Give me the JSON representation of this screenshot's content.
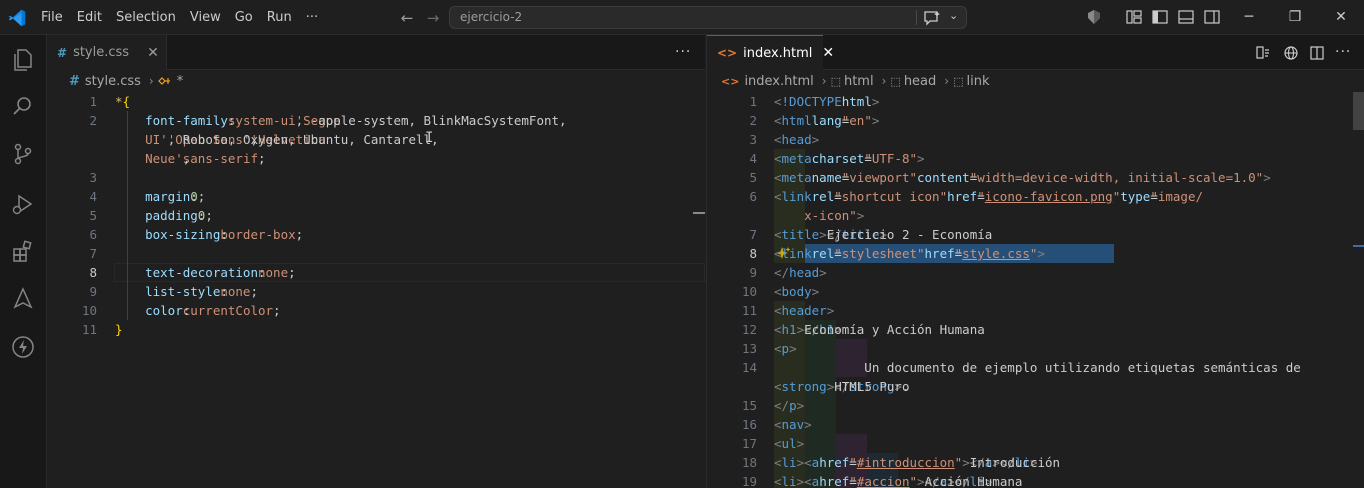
{
  "menu": [
    "File",
    "Edit",
    "Selection",
    "View",
    "Go",
    "Run",
    "···"
  ],
  "command_center": {
    "text": "ejercicio-2"
  },
  "window_controls": {
    "minimize": "─",
    "restore": "❐",
    "close": "✕"
  },
  "left_editor": {
    "tab": {
      "icon": "#",
      "label": "style.css",
      "close": "✕"
    },
    "more": "···",
    "breadcrumb": {
      "icon": "#",
      "file": "style.css",
      "sep": "›",
      "symbol": "*"
    },
    "lines": [
      {
        "n": "1",
        "segs": [
          [
            "sel",
            "*"
          ],
          [
            "brace",
            "{"
          ]
        ]
      },
      {
        "n": "2",
        "segs": [
          [
            "prop",
            "    font-family"
          ],
          [
            "txt",
            ": "
          ],
          [
            "val",
            "system-ui"
          ],
          [
            "txt",
            ", -apple-system, BlinkMacSystemFont, "
          ],
          [
            "val",
            "'Segoe"
          ]
        ]
      },
      {
        "n": "",
        "segs": [
          [
            "val",
            "    UI'"
          ],
          [
            "txt",
            ", Roboto, Oxygen, Ubuntu, Cantarell, "
          ],
          [
            "val",
            "'Open Sans'"
          ],
          [
            "txt",
            ", "
          ],
          [
            "val",
            "'Helvetica"
          ]
        ]
      },
      {
        "n": "",
        "segs": [
          [
            "val",
            "    Neue'"
          ],
          [
            "txt",
            ", "
          ],
          [
            "val",
            "sans-serif"
          ],
          [
            "txt",
            ";"
          ]
        ]
      },
      {
        "n": "3",
        "segs": []
      },
      {
        "n": "4",
        "segs": [
          [
            "prop",
            "    margin"
          ],
          [
            "txt",
            ":"
          ],
          [
            "num",
            "0"
          ],
          [
            "txt",
            ";"
          ]
        ]
      },
      {
        "n": "5",
        "segs": [
          [
            "prop",
            "    padding"
          ],
          [
            "txt",
            ": "
          ],
          [
            "num",
            "0"
          ],
          [
            "txt",
            ";"
          ]
        ]
      },
      {
        "n": "6",
        "segs": [
          [
            "prop",
            "    box-sizing"
          ],
          [
            "txt",
            ": "
          ],
          [
            "val",
            "border-box"
          ],
          [
            "txt",
            ";"
          ]
        ]
      },
      {
        "n": "7",
        "segs": []
      },
      {
        "n": "8",
        "segs": [
          [
            "prop",
            "    text-decoration"
          ],
          [
            "txt",
            ": "
          ],
          [
            "val",
            "none"
          ],
          [
            "txt",
            ";"
          ]
        ]
      },
      {
        "n": "9",
        "segs": [
          [
            "prop",
            "    list-style"
          ],
          [
            "txt",
            ": "
          ],
          [
            "val",
            "none"
          ],
          [
            "txt",
            ";"
          ]
        ]
      },
      {
        "n": "10",
        "segs": [
          [
            "prop",
            "    color"
          ],
          [
            "txt",
            ": "
          ],
          [
            "val",
            "currentColor"
          ],
          [
            "txt",
            ";"
          ]
        ]
      },
      {
        "n": "11",
        "segs": [
          [
            "brace",
            "}"
          ]
        ]
      }
    ]
  },
  "right_editor": {
    "tab": {
      "icon": "<>",
      "label": "index.html",
      "close": "✕"
    },
    "more": "···",
    "breadcrumb": [
      {
        "icon": "<>",
        "label": "index.html"
      },
      {
        "icon": "⬚",
        "label": "html"
      },
      {
        "icon": "⬚",
        "label": "head"
      },
      {
        "icon": "⬚",
        "label": "link"
      }
    ],
    "breadcrumb_sep": "›",
    "lines": [
      {
        "n": "1",
        "segs": [
          [
            "punct",
            "<"
          ],
          [
            "tag",
            "!DOCTYPE"
          ],
          [
            "txt",
            " "
          ],
          [
            "attr",
            "html"
          ],
          [
            "punct",
            ">"
          ]
        ]
      },
      {
        "n": "2",
        "segs": [
          [
            "punct",
            "<"
          ],
          [
            "tag",
            "html"
          ],
          [
            "txt",
            " "
          ],
          [
            "attr",
            "lang"
          ],
          [
            "txt",
            "="
          ],
          [
            "str",
            "\"en\""
          ],
          [
            "punct",
            ">"
          ]
        ]
      },
      {
        "n": "3",
        "segs": [
          [
            "punct",
            "<"
          ],
          [
            "tag",
            "head"
          ],
          [
            "punct",
            ">"
          ]
        ]
      },
      {
        "n": "4",
        "segs": [
          [
            "txt",
            "    "
          ],
          [
            "punct",
            "<"
          ],
          [
            "tag",
            "meta"
          ],
          [
            "txt",
            " "
          ],
          [
            "attr",
            "charset"
          ],
          [
            "txt",
            "="
          ],
          [
            "str",
            "\"UTF-8\""
          ],
          [
            "punct",
            ">"
          ]
        ]
      },
      {
        "n": "5",
        "segs": [
          [
            "txt",
            "    "
          ],
          [
            "punct",
            "<"
          ],
          [
            "tag",
            "meta"
          ],
          [
            "txt",
            " "
          ],
          [
            "attr",
            "name"
          ],
          [
            "txt",
            "="
          ],
          [
            "str",
            "\"viewport\""
          ],
          [
            "txt",
            " "
          ],
          [
            "attr",
            "content"
          ],
          [
            "txt",
            "="
          ],
          [
            "str",
            "\"width=device-width, initial-scale=1.0\""
          ],
          [
            "punct",
            ">"
          ]
        ]
      },
      {
        "n": "6",
        "segs": [
          [
            "txt",
            "    "
          ],
          [
            "punct",
            "<"
          ],
          [
            "tag",
            "link"
          ],
          [
            "txt",
            " "
          ],
          [
            "attr",
            "rel"
          ],
          [
            "txt",
            "="
          ],
          [
            "str",
            "\"shortcut icon\""
          ],
          [
            "txt",
            " "
          ],
          [
            "attr",
            "href"
          ],
          [
            "txt",
            "="
          ],
          [
            "str",
            "\""
          ],
          [
            "strl",
            "icono-favicon.png"
          ],
          [
            "str",
            "\""
          ],
          [
            "txt",
            " "
          ],
          [
            "attr",
            "type"
          ],
          [
            "txt",
            "="
          ],
          [
            "str",
            "\"image/"
          ]
        ]
      },
      {
        "n": "",
        "segs": [
          [
            "str",
            "    x-icon\""
          ],
          [
            "punct",
            ">"
          ]
        ]
      },
      {
        "n": "7",
        "segs": [
          [
            "txt",
            "    "
          ],
          [
            "punct",
            "<"
          ],
          [
            "tag",
            "title"
          ],
          [
            "punct",
            ">"
          ],
          [
            "txt",
            "Ejercicio 2 - Economía"
          ],
          [
            "punct",
            "</"
          ],
          [
            "tag",
            "title"
          ],
          [
            "punct",
            ">"
          ]
        ]
      },
      {
        "n": "8",
        "segs": [
          [
            "txt",
            "    "
          ],
          [
            "punct",
            "<"
          ],
          [
            "tag",
            "link"
          ],
          [
            "txt",
            " "
          ],
          [
            "attr",
            "rel"
          ],
          [
            "txt",
            "="
          ],
          [
            "str",
            "\"stylesheet\""
          ],
          [
            "txt",
            " "
          ],
          [
            "attr",
            "href"
          ],
          [
            "txt",
            "="
          ],
          [
            "str",
            "\""
          ],
          [
            "strl",
            "style.css"
          ],
          [
            "str",
            "\""
          ],
          [
            "punct",
            ">"
          ]
        ]
      },
      {
        "n": "9",
        "segs": [
          [
            "punct",
            "</"
          ],
          [
            "tag",
            "head"
          ],
          [
            "punct",
            ">"
          ]
        ]
      },
      {
        "n": "10",
        "segs": [
          [
            "punct",
            "<"
          ],
          [
            "tag",
            "body"
          ],
          [
            "punct",
            ">"
          ]
        ]
      },
      {
        "n": "11",
        "segs": [
          [
            "txt",
            "    "
          ],
          [
            "punct",
            "<"
          ],
          [
            "tag",
            "header"
          ],
          [
            "punct",
            ">"
          ]
        ]
      },
      {
        "n": "12",
        "segs": [
          [
            "txt",
            "        "
          ],
          [
            "punct",
            "<"
          ],
          [
            "tag",
            "h1"
          ],
          [
            "punct",
            ">"
          ],
          [
            "txt",
            "Economía y Acción Humana"
          ],
          [
            "punct",
            "</"
          ],
          [
            "tag",
            "h1"
          ],
          [
            "punct",
            ">"
          ]
        ]
      },
      {
        "n": "13",
        "segs": [
          [
            "txt",
            "        "
          ],
          [
            "punct",
            "<"
          ],
          [
            "tag",
            "p"
          ],
          [
            "punct",
            ">"
          ]
        ]
      },
      {
        "n": "14",
        "segs": [
          [
            "txt",
            "            Un documento de ejemplo utilizando etiquetas semánticas de"
          ]
        ]
      },
      {
        "n": "",
        "segs": [
          [
            "txt",
            "            "
          ],
          [
            "punct",
            "<"
          ],
          [
            "tag",
            "strong"
          ],
          [
            "punct",
            ">"
          ],
          [
            "txt",
            "HTML5 Puro"
          ],
          [
            "punct",
            "</"
          ],
          [
            "tag",
            "strong"
          ],
          [
            "punct",
            ">"
          ],
          [
            "txt",
            "."
          ]
        ]
      },
      {
        "n": "15",
        "segs": [
          [
            "txt",
            "        "
          ],
          [
            "punct",
            "</"
          ],
          [
            "tag",
            "p"
          ],
          [
            "punct",
            ">"
          ]
        ]
      },
      {
        "n": "16",
        "segs": [
          [
            "txt",
            "        "
          ],
          [
            "punct",
            "<"
          ],
          [
            "tag",
            "nav"
          ],
          [
            "punct",
            ">"
          ]
        ]
      },
      {
        "n": "17",
        "segs": [
          [
            "txt",
            "            "
          ],
          [
            "punct",
            "<"
          ],
          [
            "tag",
            "ul"
          ],
          [
            "punct",
            ">"
          ]
        ]
      },
      {
        "n": "18",
        "segs": [
          [
            "txt",
            "                "
          ],
          [
            "punct",
            "<"
          ],
          [
            "tag",
            "li"
          ],
          [
            "punct",
            "><"
          ],
          [
            "tag",
            "a"
          ],
          [
            "txt",
            " "
          ],
          [
            "attr",
            "href"
          ],
          [
            "txt",
            "="
          ],
          [
            "str",
            "\""
          ],
          [
            "strl",
            "#introduccion"
          ],
          [
            "str",
            "\""
          ],
          [
            "punct",
            ">"
          ],
          [
            "txt",
            "Introducción"
          ],
          [
            "punct",
            "</"
          ],
          [
            "tag",
            "a"
          ],
          [
            "punct",
            "></"
          ],
          [
            "tag",
            "li"
          ],
          [
            "punct",
            ">"
          ]
        ]
      },
      {
        "n": "19",
        "segs": [
          [
            "txt",
            "                "
          ],
          [
            "punct",
            "<"
          ],
          [
            "tag",
            "li"
          ],
          [
            "punct",
            "><"
          ],
          [
            "tag",
            "a"
          ],
          [
            "txt",
            " "
          ],
          [
            "attr",
            "href"
          ],
          [
            "txt",
            "="
          ],
          [
            "str",
            "\""
          ],
          [
            "strl",
            "#accion"
          ],
          [
            "str",
            "\""
          ],
          [
            "punct",
            ">"
          ],
          [
            "txt",
            "Acción Humana"
          ],
          [
            "punct",
            "</"
          ],
          [
            "tag",
            "a"
          ],
          [
            "punct",
            "></"
          ],
          [
            "tag",
            "li"
          ],
          [
            "punct",
            ">"
          ]
        ]
      }
    ]
  }
}
